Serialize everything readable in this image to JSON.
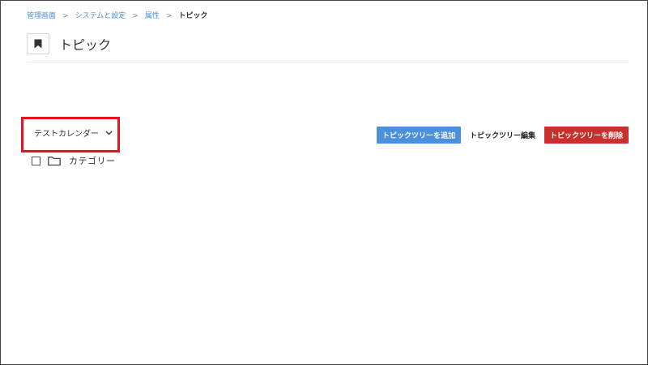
{
  "breadcrumb": {
    "items": [
      "管理画面",
      "システムと設定",
      "属性"
    ],
    "separator": ">",
    "current": "トピック"
  },
  "header": {
    "icon": "bookmark-icon",
    "title": "トピック"
  },
  "calendar_selector": {
    "value": "テストカレンダー",
    "icon": "chevron-down-icon",
    "highlight_color": "#e3141b"
  },
  "tree": {
    "items": [
      {
        "label": "カテゴリー",
        "icon": "folder-icon",
        "checked": false
      }
    ]
  },
  "actions": {
    "add_label": "トピックツリーを追加",
    "edit_label": "トピックツリー編集",
    "delete_label": "トピックツリーを削除"
  },
  "colors": {
    "link": "#4a8fd8",
    "add_button": "#4a90dc",
    "delete_button": "#c9302c"
  }
}
